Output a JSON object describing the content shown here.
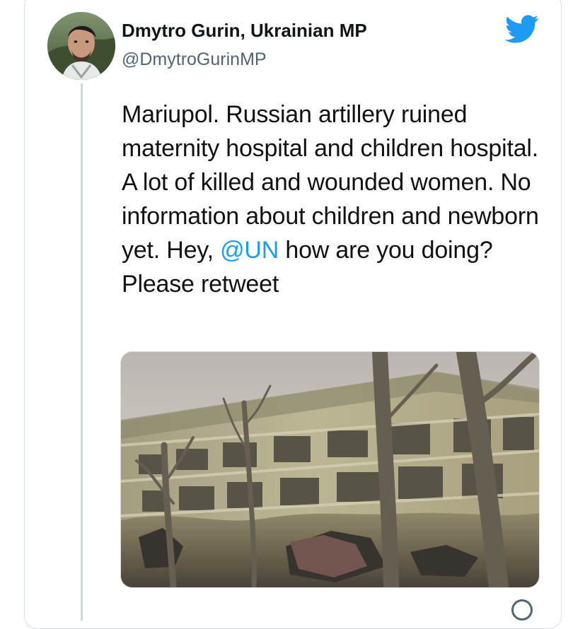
{
  "tweet": {
    "author": {
      "display_name": "Dmytro Gurin, Ukrainian MP",
      "handle": "@DmytroGurinMP",
      "avatar_icon": "profile-photo"
    },
    "platform_icon": "twitter-bird-icon",
    "text_parts": {
      "before_mention": "Mariupol. Russian artillery ruined maternity hospital and children hospital. A lot of killed and wounded women. No information about children and newborn yet. Hey, ",
      "mention": "@UN",
      "after_mention": " how are you doing? Please retweet"
    },
    "media": {
      "type": "photo",
      "description_icon": "damaged-hospital-building-photo"
    },
    "colors": {
      "mention": "#1d9bf0",
      "twitter_blue": "#1d9bf0",
      "handle": "#536471",
      "text": "#111111"
    }
  }
}
